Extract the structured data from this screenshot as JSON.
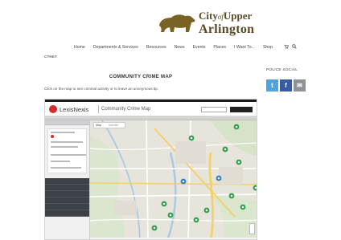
{
  "header": {
    "logo": {
      "line1_prefix": "City",
      "line1_of": "of",
      "line1_suffix": "Upper",
      "line2": "Arlington"
    },
    "nav": [
      {
        "label": "Home"
      },
      {
        "label": "Departments & Services"
      },
      {
        "label": "Resources"
      },
      {
        "label": "News"
      },
      {
        "label": "Events"
      },
      {
        "label": "Places"
      },
      {
        "label": "I Want To..."
      },
      {
        "label": "Shop"
      }
    ],
    "nav_icons": [
      "cart-icon",
      "search-icon"
    ]
  },
  "breadcrumb": "CTHET",
  "main": {
    "title": "COMMUNITY CRIME MAP",
    "intro": "Click on the map to see criminal activity or to leave an anonymous tip."
  },
  "sidebar": {
    "title": "POLICE SOCIAL",
    "social": [
      {
        "name": "twitter",
        "glyph": "t",
        "color": "#4fa3e0"
      },
      {
        "name": "facebook",
        "glyph": "f",
        "color": "#3b5ba0"
      },
      {
        "name": "email",
        "glyph": "✉",
        "color": "#8d9299"
      }
    ]
  },
  "embed": {
    "brand": "LexisNexis",
    "app_title": "Community Crime Map",
    "map_tabs": [
      "Map",
      "Satellite"
    ],
    "colors": {
      "brand": "#d22c2c",
      "marker": "#2e9e48",
      "marker_alt": "#2a7fd0"
    }
  }
}
